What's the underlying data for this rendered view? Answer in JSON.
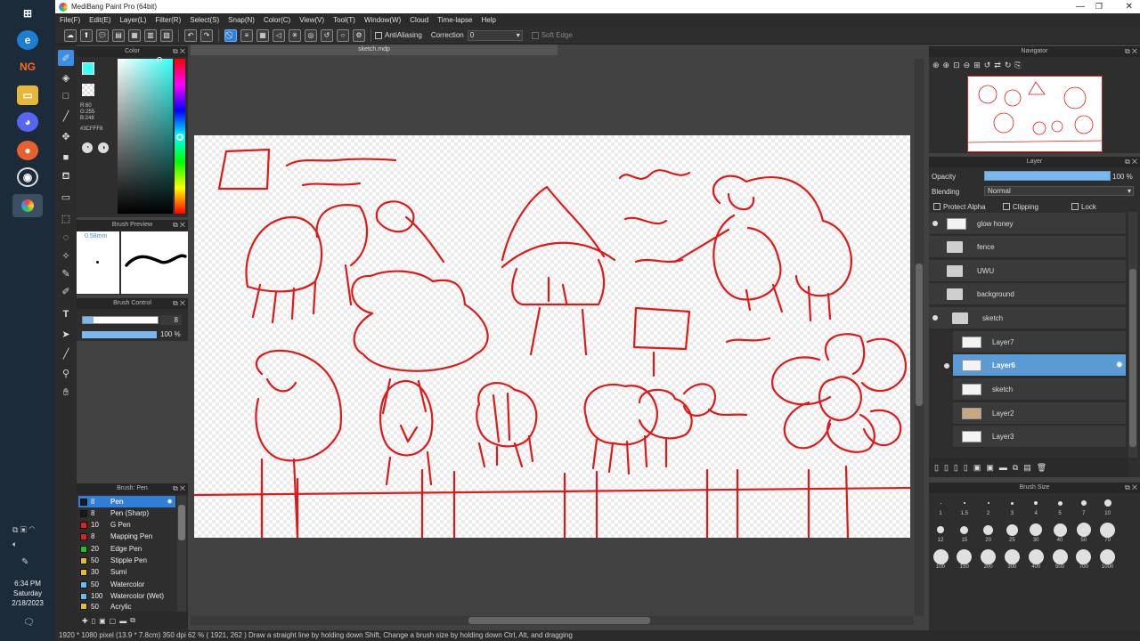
{
  "window": {
    "title": "MediBang Paint Pro (64bit)"
  },
  "menu": [
    "File(F)",
    "Edit(E)",
    "Layer(L)",
    "Filter(R)",
    "Select(S)",
    "Snap(N)",
    "Color(C)",
    "View(V)",
    "Tool(T)",
    "Window(W)",
    "Cloud",
    "Time-lapse",
    "Help"
  ],
  "toolbar": {
    "antialiasing": "AntiAliasing",
    "correction_label": "Correction",
    "correction_value": "0",
    "soft_edge": "Soft Edge"
  },
  "color_panel": {
    "title": "Color",
    "r": "R:60",
    "g": "G:255",
    "b": "B:248",
    "hex": "#3CFFF8",
    "accent": "#3CFFF8",
    "secondary": "#FF3C9C"
  },
  "brush_preview": {
    "title": "Brush Preview",
    "size": "0.58mm"
  },
  "brush_control": {
    "title": "Brush Control",
    "size_value": "8",
    "opacity_value": "100 %"
  },
  "brush_list": {
    "title": "Brush: Pen",
    "items": [
      {
        "size": "8",
        "name": "Pen",
        "color": "#1a1a1a"
      },
      {
        "size": "8",
        "name": "Pen (Sharp)",
        "color": "#1a1a1a"
      },
      {
        "size": "10",
        "name": "G Pen",
        "color": "#e02020"
      },
      {
        "size": "8",
        "name": "Mapping Pen",
        "color": "#e02020"
      },
      {
        "size": "20",
        "name": "Edge Pen",
        "color": "#20c020"
      },
      {
        "size": "50",
        "name": "Stipple Pen",
        "color": "#e0c020"
      },
      {
        "size": "30",
        "name": "Sumi",
        "color": "#e0c020"
      },
      {
        "size": "50",
        "name": "Watercolor",
        "color": "#60c0f0"
      },
      {
        "size": "100",
        "name": "Watercolor (Wet)",
        "color": "#60c0f0"
      },
      {
        "size": "50",
        "name": "Acrylic",
        "color": "#e0c020"
      }
    ]
  },
  "document": {
    "tab": "sketch.mdp"
  },
  "navigator": {
    "title": "Navigator"
  },
  "layer_panel": {
    "title": "Layer",
    "opacity_label": "Opacity",
    "opacity_value": "100 %",
    "opacity": 1.0,
    "blending_label": "Blending",
    "blending_value": "Normal",
    "protect_alpha": "Protect Alpha",
    "clipping": "Clipping",
    "lock": "Lock",
    "layers": [
      {
        "name": "glow honey",
        "type": "layer",
        "visible": true
      },
      {
        "name": "fence",
        "type": "folder",
        "visible": false
      },
      {
        "name": "UWU",
        "type": "folder",
        "visible": false
      },
      {
        "name": "background",
        "type": "folder",
        "visible": false
      },
      {
        "name": "sketch",
        "type": "folder",
        "visible": true
      },
      {
        "name": "Layer7",
        "type": "layer",
        "visible": false
      },
      {
        "name": "Layer6",
        "type": "layer",
        "visible": true,
        "selected": true
      },
      {
        "name": "sketch",
        "type": "layer",
        "visible": false
      },
      {
        "name": "Layer2",
        "type": "layer",
        "visible": false
      },
      {
        "name": "Layer3",
        "type": "layer",
        "visible": false
      }
    ]
  },
  "brush_size": {
    "title": "Brush Size",
    "sizes": [
      "1",
      "1.5",
      "2",
      "3",
      "4",
      "5",
      "7",
      "10",
      "12",
      "15",
      "20",
      "25",
      "30",
      "40",
      "50",
      "70",
      "100",
      "150",
      "200",
      "300",
      "400",
      "500",
      "700",
      "1000"
    ]
  },
  "status": {
    "text": "1920 * 1080 pixel   (13.9 * 7.8cm)   350 dpi   62 %   ( 1921, 262 )   Draw a straight line by holding down Shift, Change a brush size by holding down Ctrl, Alt, and dragging"
  },
  "clock": {
    "time": "6:34 PM",
    "day": "Saturday",
    "date": "2/18/2023"
  }
}
